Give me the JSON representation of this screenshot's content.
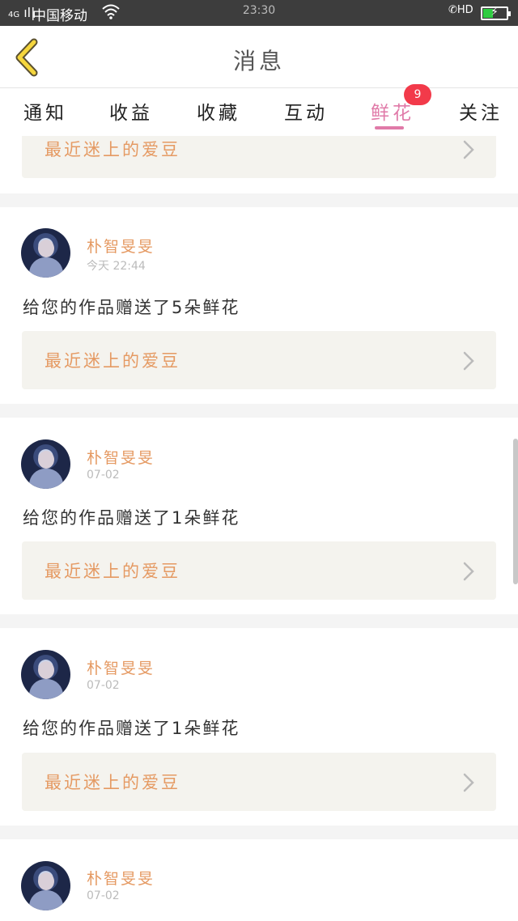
{
  "status_bar": {
    "signal": "4G",
    "carrier": "中国移动",
    "time": "23:30",
    "hd_label": "HD",
    "battery_level": 0.4
  },
  "nav": {
    "title": "消息"
  },
  "tabs": [
    {
      "label": "通知"
    },
    {
      "label": "收益"
    },
    {
      "label": "收藏"
    },
    {
      "label": "互动"
    },
    {
      "label": "鲜花"
    },
    {
      "label": "关注"
    }
  ],
  "active_tab": "鲜花",
  "badge": "9",
  "recommend_label": "最近迷上的爱豆",
  "messages": [
    {
      "name": "朴智旻旻",
      "time": "今天 22:44",
      "text": "给您的作品赠送了5朵鲜花"
    },
    {
      "name": "朴智旻旻",
      "time": "07-02",
      "text": "给您的作品赠送了1朵鲜花"
    },
    {
      "name": "朴智旻旻",
      "time": "07-02",
      "text": "给您的作品赠送了1朵鲜花"
    },
    {
      "name": "朴智旻旻",
      "time": "07-02",
      "text": ""
    }
  ],
  "colors": {
    "accent": "#e07aa8",
    "badge": "#f23a4a",
    "name": "#e59a63",
    "back_arrow": "#f5d63d"
  }
}
